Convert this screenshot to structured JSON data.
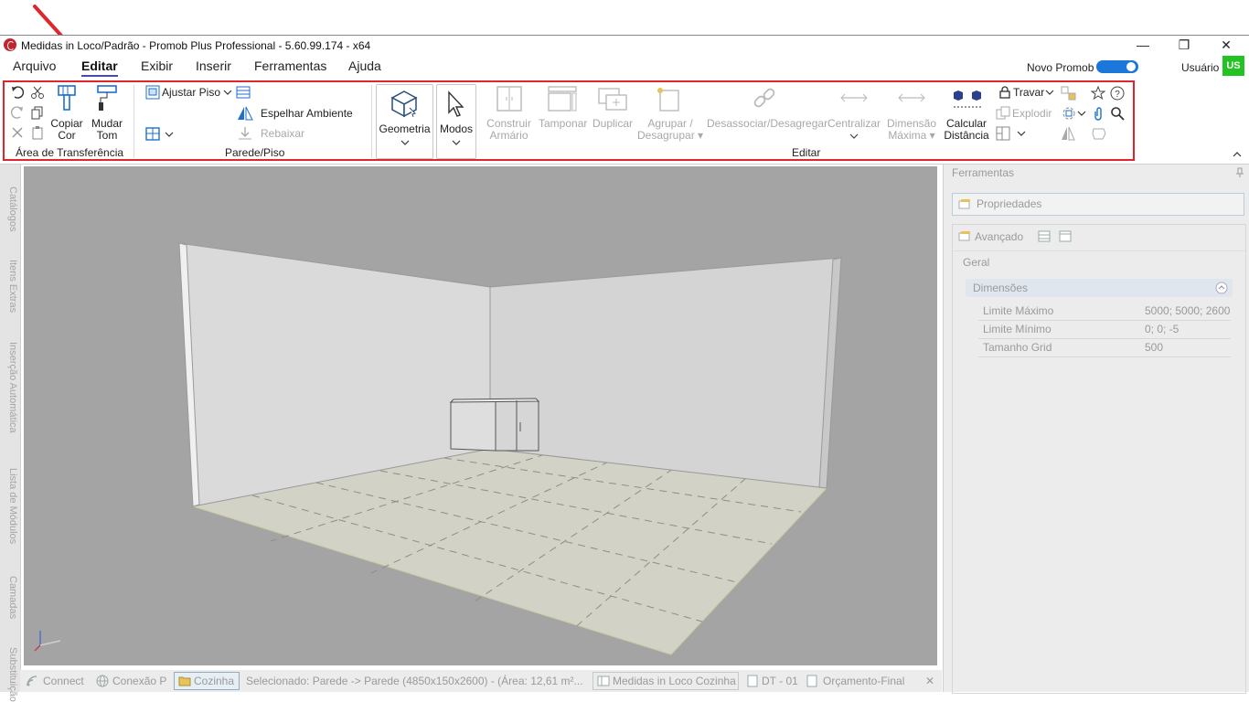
{
  "window": {
    "title": "Medidas in Loco/Padrão - Promob Plus Professional - 5.60.99.174 - x64",
    "minimize_glyph": "—",
    "restore_glyph": "❐",
    "close_glyph": "✕"
  },
  "menu": {
    "items": [
      "Arquivo",
      "Editar",
      "Exibir",
      "Inserir",
      "Ferramentas",
      "Ajuda"
    ],
    "active": "Editar",
    "novo_promob_label": "Novo Promob",
    "novo_promob_on": true,
    "user_label": "Usuário",
    "user_initials": "US",
    "user_color": "#22c322",
    "toggle_color": "#1b77d9"
  },
  "annotation": {
    "arrow_color": "#e0262d",
    "highlight_color": "#e0262d"
  },
  "ribbon": {
    "clipboard": {
      "copiar_cor": [
        "Copiar",
        "Cor"
      ],
      "mudar_tom": [
        "Mudar",
        "Tom"
      ],
      "group_label": "Área de Transferência"
    },
    "parede_piso": {
      "ajustar_piso": "Ajustar Piso",
      "espelhar_ambiente": "Espelhar Ambiente",
      "rebaixar": "Rebaixar",
      "group_label": "Parede/Piso"
    },
    "geometria": "Geometria",
    "modos": "Modos",
    "editar": {
      "construir_armario": [
        "Construir",
        "Armário"
      ],
      "tamponar": "Tamponar",
      "duplicar": "Duplicar",
      "agrupar": [
        "Agrupar /",
        "Desagrupar"
      ],
      "desassociar": "Desassociar/Desagregar",
      "centralizar": "Centralizar",
      "dimensao_maxima": [
        "Dimensão",
        "Máxima"
      ],
      "calcular_distancia": [
        "Calcular",
        "Distância"
      ],
      "travar": "Travar",
      "explodir": "Explodir",
      "group_label": "Editar"
    }
  },
  "left_dock": {
    "tabs": [
      "Catálogos",
      "Itens Extras",
      "Inserção Automática",
      "Lista de Módulos",
      "Camadas",
      "Substituição"
    ]
  },
  "status_bar": {
    "connect": "Connect",
    "conexao": "Conexão P",
    "cozinha": "Cozinha",
    "selecionado": "Selecionado: Parede -> Parede (4850x150x2600) - (Área: 12,61 m²...",
    "doc_tab": "Medidas in Loco Cozinha",
    "dt": "DT - 01",
    "orcamento": "Orçamento-Final",
    "close_glyph": "✕"
  },
  "right_panel": {
    "title": "Ferramentas",
    "propriedades": "Propriedades",
    "avancado": "Avançado",
    "tab_geral": "Geral",
    "section_dimensoes": "Dimensões",
    "rows": [
      {
        "label": "Limite Máximo",
        "value": "5000; 5000; 2600"
      },
      {
        "label": "Limite Mínimo",
        "value": "0; 0; -5"
      },
      {
        "label": "Tamanho Grid",
        "value": "500"
      }
    ]
  }
}
